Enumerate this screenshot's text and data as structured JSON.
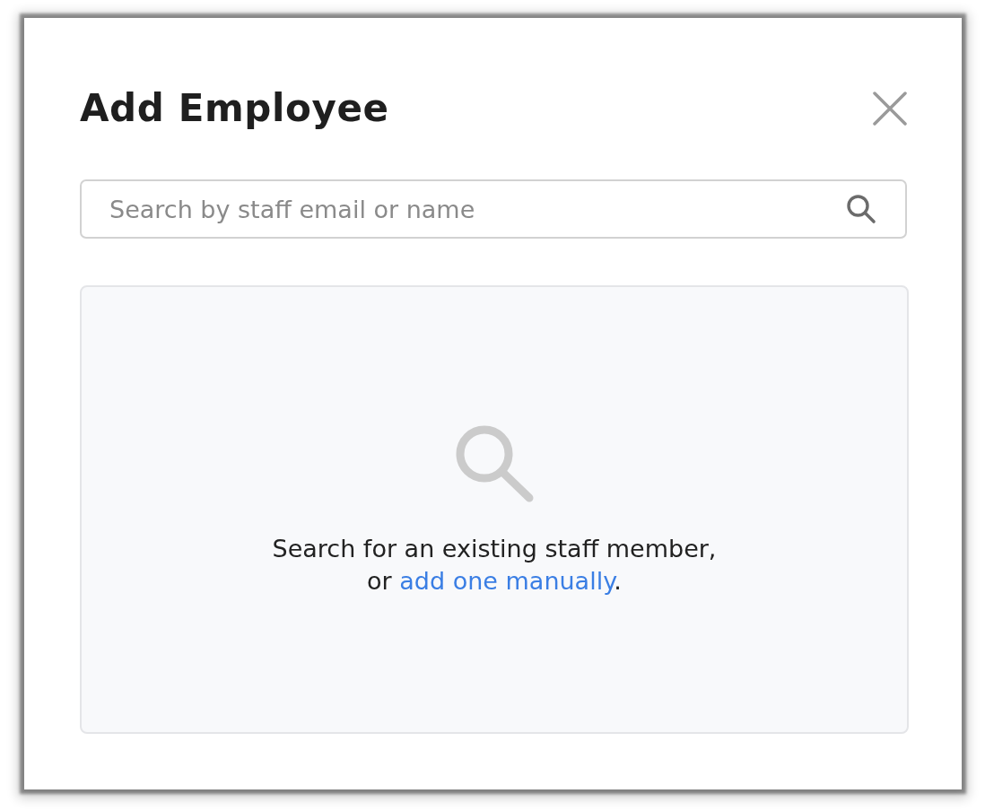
{
  "dialog": {
    "title": "Add Employee"
  },
  "search": {
    "placeholder": "Search by staff email or name"
  },
  "empty_state": {
    "line_1": "Search for an existing staff member,",
    "line_2_prefix": "or",
    "link": "add one manually",
    "line_2_suffix": "."
  }
}
